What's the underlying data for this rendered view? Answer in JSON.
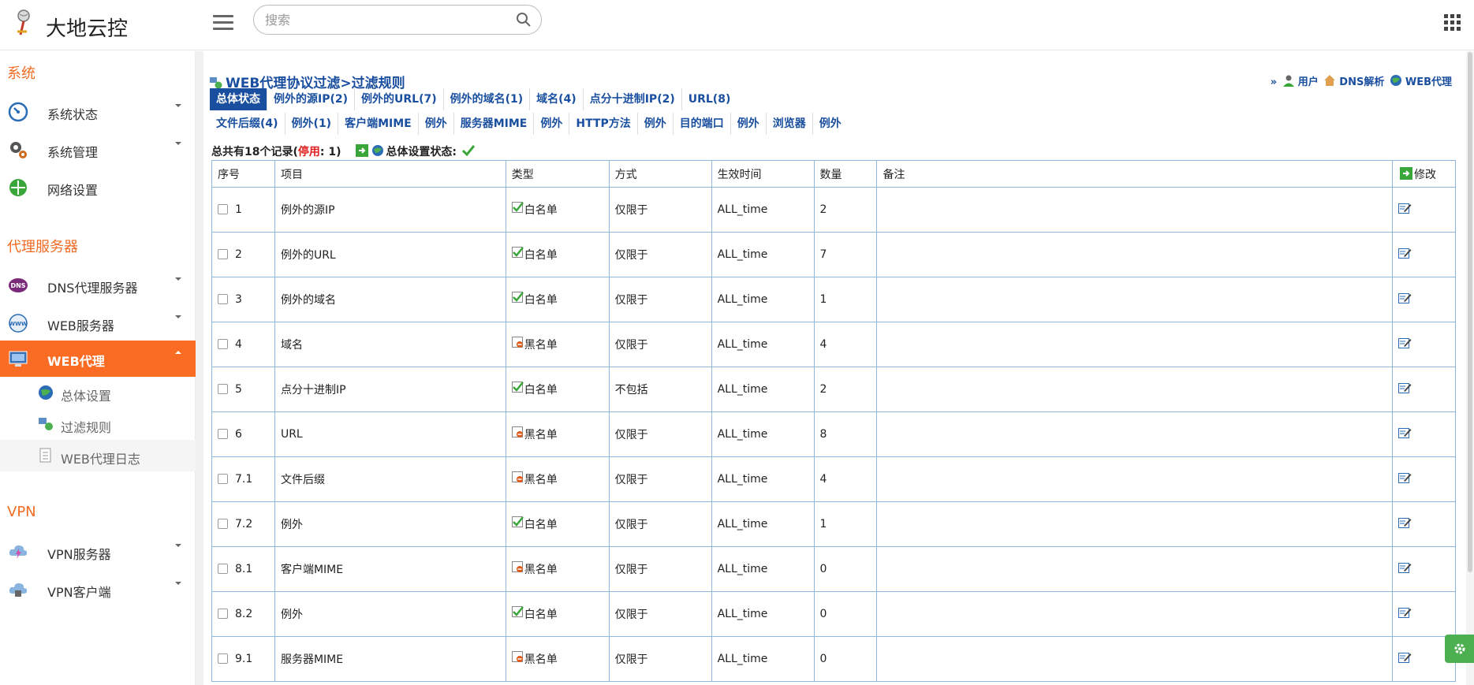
{
  "header": {
    "app_title": "大地云控",
    "search_placeholder": "搜索"
  },
  "sidebar": {
    "sections": [
      {
        "title": "系统",
        "items": [
          {
            "label": "系统状态",
            "icon": "dashboard-icon"
          },
          {
            "label": "系统管理",
            "icon": "gears-icon"
          },
          {
            "label": "网络设置",
            "icon": "network-icon"
          }
        ]
      },
      {
        "title": "代理服务器",
        "items": [
          {
            "label": "DNS代理服务器",
            "icon": "dns-icon"
          },
          {
            "label": "WEB服务器",
            "icon": "www-icon"
          },
          {
            "label": "WEB代理",
            "icon": "proxy-icon",
            "active": true,
            "subitems": [
              {
                "label": "总体设置",
                "icon": "globe-icon"
              },
              {
                "label": "过滤规则",
                "icon": "filter-icon"
              },
              {
                "label": "WEB代理日志",
                "icon": "log-icon"
              }
            ]
          }
        ]
      },
      {
        "title": "VPN",
        "items": [
          {
            "label": "VPN服务器",
            "icon": "cloud-server-icon"
          },
          {
            "label": "VPN客户端",
            "icon": "cloud-client-icon"
          }
        ]
      }
    ]
  },
  "main": {
    "page_title": "WEB代理协议过滤>过滤规则",
    "right_links": {
      "prefix": "»",
      "user": "用户",
      "dns": "DNS解析",
      "web": "WEB代理"
    },
    "tabs_row1": [
      "总体状态",
      "例外的源IP(2)",
      "例外的URL(7)",
      "例外的域名(1)",
      "域名(4)",
      "点分十进制IP(2)",
      "URL(8)"
    ],
    "tabs_row2": [
      "文件后缀(4)",
      "例外(1)",
      "客户端MIME",
      "例外",
      "服务器MIME",
      "例外",
      "HTTP方法",
      "例外",
      "目的端口",
      "例外",
      "浏览器",
      "例外"
    ],
    "summary": {
      "prefix": "总共有18个记录(",
      "disabled_label": "停用",
      "disabled_count": ": 1)",
      "status_label": "总体设置状态:"
    },
    "table": {
      "headers": [
        "序号",
        "项目",
        "类型",
        "方式",
        "生效时间",
        "数量",
        "备注",
        "修改"
      ],
      "rows": [
        {
          "no": "1",
          "item": "例外的源IP",
          "type": "白名单",
          "white": true,
          "mode": "仅限于",
          "time": "ALL_time",
          "count": "2",
          "note": ""
        },
        {
          "no": "2",
          "item": "例外的URL",
          "type": "白名单",
          "white": true,
          "mode": "仅限于",
          "time": "ALL_time",
          "count": "7",
          "note": ""
        },
        {
          "no": "3",
          "item": "例外的域名",
          "type": "白名单",
          "white": true,
          "mode": "仅限于",
          "time": "ALL_time",
          "count": "1",
          "note": ""
        },
        {
          "no": "4",
          "item": "域名",
          "type": "黑名单",
          "white": false,
          "mode": "仅限于",
          "time": "ALL_time",
          "count": "4",
          "note": ""
        },
        {
          "no": "5",
          "item": "点分十进制IP",
          "type": "白名单",
          "white": true,
          "mode": "不包括",
          "time": "ALL_time",
          "count": "2",
          "note": ""
        },
        {
          "no": "6",
          "item": "URL",
          "type": "黑名单",
          "white": false,
          "mode": "仅限于",
          "time": "ALL_time",
          "count": "8",
          "note": ""
        },
        {
          "no": "7.1",
          "item": "文件后缀",
          "type": "黑名单",
          "white": false,
          "mode": "仅限于",
          "time": "ALL_time",
          "count": "4",
          "note": ""
        },
        {
          "no": "7.2",
          "item": "例外",
          "type": "白名单",
          "white": true,
          "mode": "仅限于",
          "time": "ALL_time",
          "count": "1",
          "note": ""
        },
        {
          "no": "8.1",
          "item": "客户端MIME",
          "type": "黑名单",
          "white": false,
          "mode": "仅限于",
          "time": "ALL_time",
          "count": "0",
          "note": ""
        },
        {
          "no": "8.2",
          "item": "例外",
          "type": "白名单",
          "white": true,
          "mode": "仅限于",
          "time": "ALL_time",
          "count": "0",
          "note": ""
        },
        {
          "no": "9.1",
          "item": "服务器MIME",
          "type": "黑名单",
          "white": false,
          "mode": "仅限于",
          "time": "ALL_time",
          "count": "0",
          "note": ""
        }
      ]
    }
  },
  "colors": {
    "accent": "#fa6b23",
    "link": "#1a4fa0",
    "table_border": "#8fb6dd",
    "check_green": "#3aa63a",
    "warn_red": "#e02020"
  }
}
